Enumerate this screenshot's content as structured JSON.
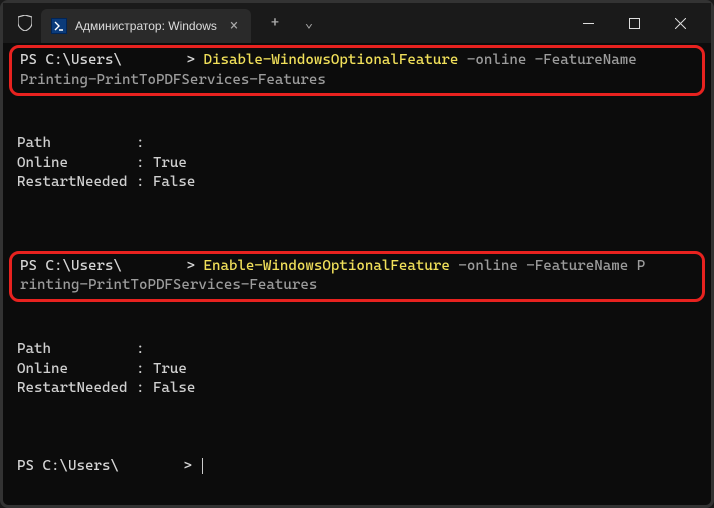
{
  "titlebar": {
    "tab_title": "Администратор: Windows Po",
    "new_tab": "+",
    "dropdown": "⌄",
    "close_tab": "×"
  },
  "window": {
    "minimize": "—",
    "maximize": "☐",
    "close": "✕"
  },
  "terminal": {
    "prompt_prefix": "PS C:\\Users\\",
    "prompt_suffix": " >",
    "cmd1_name": "Disable-WindowsOptionalFeature",
    "cmd1_args": " -online -FeatureName ",
    "cmd1_feature": "Printing-PrintToPDFServices-Features",
    "cmd2_name": "Enable-WindowsOptionalFeature",
    "cmd2_args": " -online -FeatureName ",
    "cmd2_feature_p1": "P",
    "cmd2_feature_p2": "rinting-PrintToPDFServices-Features",
    "output1": {
      "path_label": "Path          :",
      "online_label": "Online        : ",
      "online_value": "True",
      "restart_label": "RestartNeeded : ",
      "restart_value": "False"
    },
    "output2": {
      "path_label": "Path          :",
      "online_label": "Online        : ",
      "online_value": "True",
      "restart_label": "RestartNeeded : ",
      "restart_value": "False"
    }
  }
}
